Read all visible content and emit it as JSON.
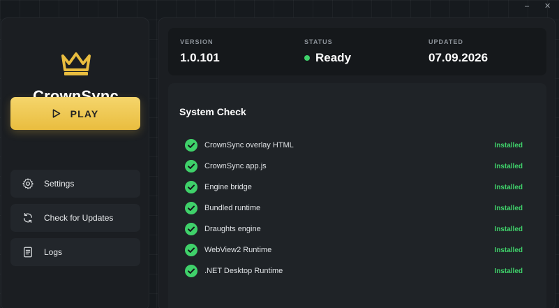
{
  "window": {
    "minimize_glyph": "–",
    "close_glyph": "✕"
  },
  "app": {
    "name": "CrownSync",
    "logo_icon": "crown-icon",
    "accent_color": "#e9bd3f"
  },
  "sidebar": {
    "play_label": "PLAY",
    "items": [
      {
        "label": "Settings",
        "icon": "gear-icon"
      },
      {
        "label": "Check for Updates",
        "icon": "refresh-icon"
      },
      {
        "label": "Logs",
        "icon": "document-icon"
      }
    ]
  },
  "info": {
    "version_label": "VERSION",
    "version_value": "1.0.101",
    "status_label": "STATUS",
    "status_value": "Ready",
    "status_color": "#3fd16a",
    "updated_label": "UPDATED",
    "updated_value": "07.09.2026"
  },
  "system_check": {
    "title": "System Check",
    "items": [
      {
        "name": "CrownSync overlay HTML",
        "state": "Installed"
      },
      {
        "name": "CrownSync app.js",
        "state": "Installed"
      },
      {
        "name": "Engine bridge",
        "state": "Installed"
      },
      {
        "name": "Bundled runtime",
        "state": "Installed"
      },
      {
        "name": "Draughts engine",
        "state": "Installed"
      },
      {
        "name": "WebView2 Runtime",
        "state": "Installed"
      },
      {
        "name": ".NET Desktop Runtime",
        "state": "Installed"
      }
    ]
  }
}
